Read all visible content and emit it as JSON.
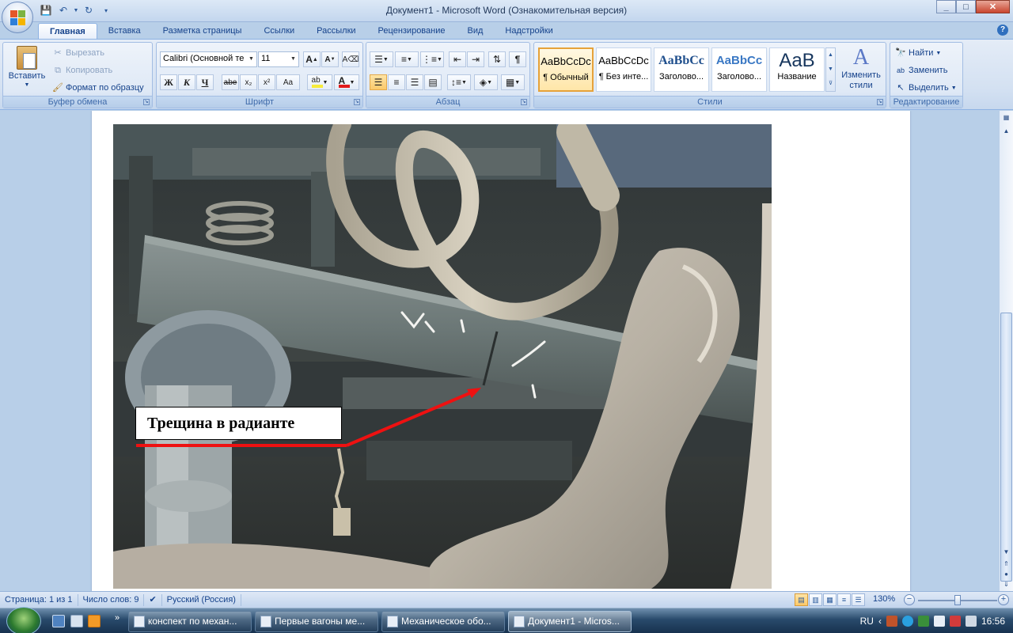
{
  "window": {
    "title": "Документ1 - Microsoft Word (Ознакомительная версия)",
    "min": "_",
    "max": "□",
    "close": "✕"
  },
  "tabs": [
    "Главная",
    "Вставка",
    "Разметка страницы",
    "Ссылки",
    "Рассылки",
    "Рецензирование",
    "Вид",
    "Надстройки"
  ],
  "clipboard": {
    "paste": "Вставить",
    "cut": "Вырезать",
    "copy": "Копировать",
    "format_painter": "Формат по образцу",
    "label": "Буфер обмена"
  },
  "font": {
    "name": "Calibri (Основной те",
    "size": "11",
    "label": "Шрифт",
    "bold": "Ж",
    "italic": "К",
    "underline": "Ч",
    "strike": "abe",
    "subscript": "x₂",
    "superscript": "x²",
    "case": "Aa"
  },
  "paragraph": {
    "label": "Абзац"
  },
  "styles": {
    "label": "Стили",
    "items": [
      {
        "sample": "AaBbCcDc",
        "name": "¶ Обычный"
      },
      {
        "sample": "AaBbCcDc",
        "name": "¶ Без инте..."
      },
      {
        "sample": "AaBbCc",
        "name": "Заголово..."
      },
      {
        "sample": "AaBbCc",
        "name": "Заголово..."
      },
      {
        "sample": "AaB",
        "name": "Название"
      }
    ],
    "change": "Изменить стили"
  },
  "editing": {
    "label": "Редактирование",
    "find": "Найти",
    "replace": "Заменить",
    "select": "Выделить"
  },
  "document": {
    "callout": "Трещина в радианте",
    "arrow_color": "#ee1111"
  },
  "status": {
    "page": "Страница: 1 из 1",
    "words": "Число слов: 9",
    "language": "Русский (Россия)",
    "zoom": "130%"
  },
  "taskbar": {
    "tasks": [
      {
        "label": "конспект по механ...",
        "active": false
      },
      {
        "label": "Первые вагоны ме...",
        "active": false
      },
      {
        "label": "Механическое обо...",
        "active": false
      },
      {
        "label": "Документ1 - Micros...",
        "active": true
      }
    ],
    "lang": "RU",
    "clock": "16:56"
  }
}
